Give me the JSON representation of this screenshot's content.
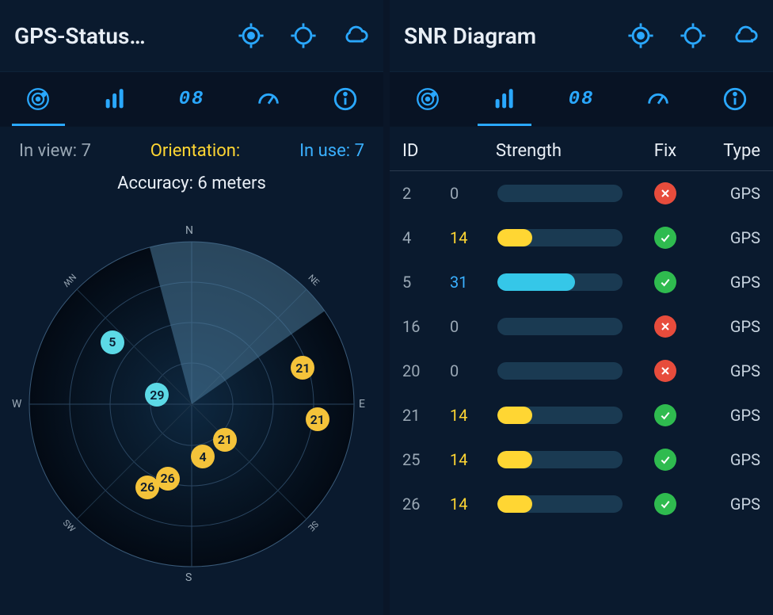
{
  "left": {
    "title": "GPS-Status…",
    "tabs": [
      "radar",
      "bars",
      "digital",
      "gauge",
      "info"
    ],
    "active_tab": 0,
    "status": {
      "in_view_label": "In view:",
      "in_view_value": "7",
      "orientation_label": "Orientation:",
      "in_use_label": "In use:",
      "in_use_value": "7"
    },
    "accuracy_label": "Accuracy: 6 meters",
    "radar": {
      "compass": [
        "N",
        "NE",
        "E",
        "SE",
        "S",
        "SW",
        "W",
        "NW"
      ],
      "sweep_start_deg": 345,
      "sweep_end_deg": 55,
      "satellites": [
        {
          "id": "5",
          "color": "cyan",
          "r_pct": 62,
          "az_deg": 308
        },
        {
          "id": "29",
          "color": "cyan",
          "r_pct": 22,
          "az_deg": 285
        },
        {
          "id": "21",
          "color": "yellow",
          "r_pct": 72,
          "az_deg": 72
        },
        {
          "id": "21",
          "color": "yellow",
          "r_pct": 78,
          "az_deg": 97
        },
        {
          "id": "21",
          "color": "yellow",
          "r_pct": 30,
          "az_deg": 137
        },
        {
          "id": "4",
          "color": "yellow",
          "r_pct": 33,
          "az_deg": 168
        },
        {
          "id": "26",
          "color": "yellow",
          "r_pct": 48,
          "az_deg": 198
        },
        {
          "id": "26",
          "color": "yellow",
          "r_pct": 58,
          "az_deg": 208
        }
      ]
    }
  },
  "right": {
    "title": "SNR Diagram",
    "tabs": [
      "radar",
      "bars",
      "digital",
      "gauge",
      "info"
    ],
    "active_tab": 1,
    "columns": {
      "id": "ID",
      "strength": "Strength",
      "fix": "Fix",
      "type": "Type"
    },
    "rows": [
      {
        "id": "2",
        "value": 0,
        "fix": false,
        "type": "GPS"
      },
      {
        "id": "4",
        "value": 14,
        "fix": true,
        "type": "GPS"
      },
      {
        "id": "5",
        "value": 31,
        "fix": true,
        "type": "GPS"
      },
      {
        "id": "16",
        "value": 0,
        "fix": false,
        "type": "GPS"
      },
      {
        "id": "20",
        "value": 0,
        "fix": false,
        "type": "GPS"
      },
      {
        "id": "21",
        "value": 14,
        "fix": true,
        "type": "GPS"
      },
      {
        "id": "25",
        "value": 14,
        "fix": true,
        "type": "GPS"
      },
      {
        "id": "26",
        "value": 14,
        "fix": true,
        "type": "GPS"
      }
    ],
    "bar_max": 50
  },
  "icons": {
    "locate": "locate-icon",
    "target": "target-icon",
    "cloud": "cloud-icon"
  },
  "colors": {
    "accent": "#2aa8ff",
    "yellow": "#ffd633",
    "cyan": "#35c7e8",
    "ok": "#2fbb4f",
    "bad": "#e74c3c"
  },
  "chart_data": {
    "type": "table",
    "title": "SNR Diagram",
    "columns": [
      "ID",
      "Strength",
      "Fix",
      "Type"
    ],
    "rows": [
      [
        2,
        0,
        false,
        "GPS"
      ],
      [
        4,
        14,
        true,
        "GPS"
      ],
      [
        5,
        31,
        true,
        "GPS"
      ],
      [
        16,
        0,
        false,
        "GPS"
      ],
      [
        20,
        0,
        false,
        "GPS"
      ],
      [
        21,
        14,
        true,
        "GPS"
      ],
      [
        25,
        14,
        true,
        "GPS"
      ],
      [
        26,
        14,
        true,
        "GPS"
      ]
    ]
  }
}
